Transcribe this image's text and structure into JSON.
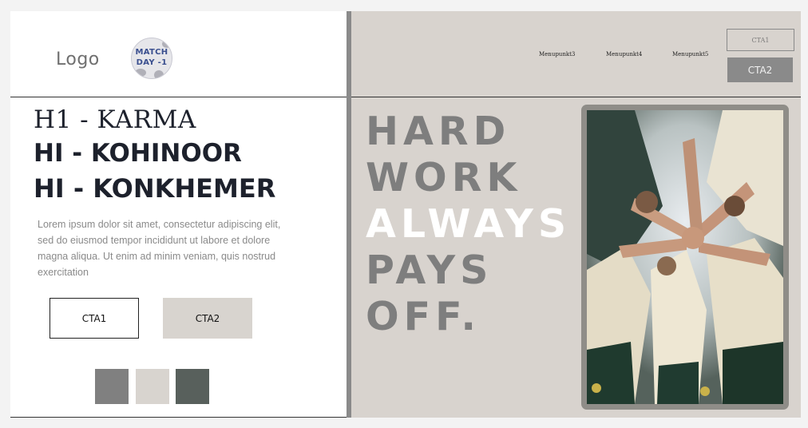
{
  "left_header": {
    "logo_text": "Logo",
    "badge_line1": "MATCH",
    "badge_line2": "DAY -1"
  },
  "typography": {
    "h1_karma": "H1 - KARMA",
    "h1_kohinoor": "HI - KOHINOOR",
    "h1_konkhemer": "HI - KONKHEMER"
  },
  "body_text": "Lorem ipsum dolor sit amet, consectetur adipiscing elit, sed do eiusmod tempor incididunt ut labore et dolore magna aliqua. Ut enim ad minim veniam, quis nostrud exercitation",
  "left_ctas": {
    "cta1": "CTA1",
    "cta2": "CTA2"
  },
  "swatches": [
    "#808080",
    "#d8d4cf",
    "#58605c"
  ],
  "right_header": {
    "menu_items": [
      "Menupunkt3",
      "Menupunkt4",
      "Menupunkt5"
    ],
    "cta1": "CTA1",
    "cta2": "CTA2"
  },
  "hero": {
    "lines": [
      "HARD",
      "WORK",
      "ALWAYS",
      "PAYS",
      "OFF."
    ]
  },
  "colors": {
    "panel_bg": "#d8d3ce",
    "accent_grey": "#8a8a8a",
    "dark_text": "#1d212c",
    "hero_highlight": "#ffffff"
  }
}
